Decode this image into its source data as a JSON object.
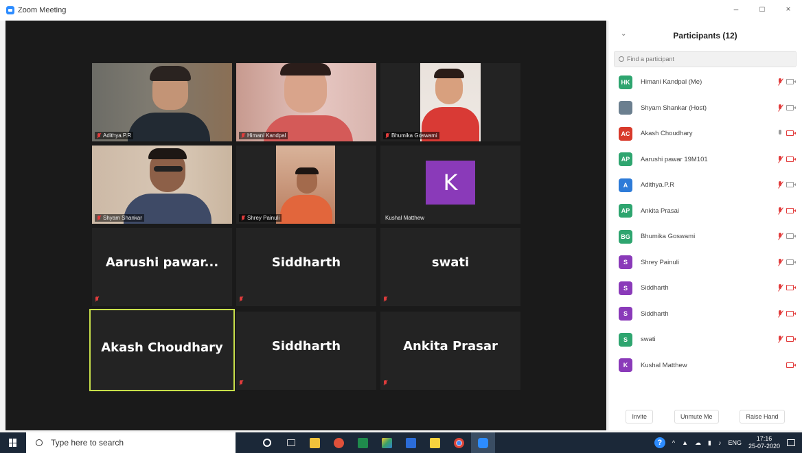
{
  "window": {
    "title": "Zoom Meeting",
    "min": "–",
    "max": "□",
    "close": "×"
  },
  "tiles": [
    {
      "name": "Adithya.P.R",
      "type": "video"
    },
    {
      "name": "Himani Kandpal",
      "type": "video"
    },
    {
      "name": "Bhumika Goswami",
      "type": "video"
    },
    {
      "name": "Shyam Shankar",
      "type": "video"
    },
    {
      "name": "Shrey Painuli",
      "type": "video"
    },
    {
      "name": "Kushal Matthew",
      "type": "avatar",
      "initial": "K"
    },
    {
      "name": "Aarushi  pawar...",
      "type": "name"
    },
    {
      "name": "Siddharth",
      "type": "name"
    },
    {
      "name": "swati",
      "type": "name"
    },
    {
      "name": "Akash Choudhary",
      "type": "name",
      "active": true
    },
    {
      "name": "Siddharth",
      "type": "name"
    },
    {
      "name": "Ankita Prasar",
      "type": "name"
    }
  ],
  "panel": {
    "title": "Participants (12)",
    "search_placeholder": "Find a participant",
    "participants": [
      {
        "initials": "HK",
        "name": "Himani Kandpal (Me)",
        "color": "#2ea56f",
        "mic": "muted",
        "cam": "on"
      },
      {
        "initials": "",
        "name": "Shyam Shankar (Host)",
        "color": "#6b7f8f",
        "mic": "muted",
        "cam": "on"
      },
      {
        "initials": "AC",
        "name": "Akash Choudhary",
        "color": "#d83a2b",
        "mic": "on",
        "cam": "off"
      },
      {
        "initials": "AP",
        "name": "Aarushi pawar 19M101",
        "color": "#2ea56f",
        "mic": "muted",
        "cam": "off"
      },
      {
        "initials": "A",
        "name": "Adithya.P.R",
        "color": "#2d7bd8",
        "mic": "muted",
        "cam": "on"
      },
      {
        "initials": "AP",
        "name": "Ankita Prasai",
        "color": "#2ea56f",
        "mic": "muted",
        "cam": "off"
      },
      {
        "initials": "BG",
        "name": "Bhumika Goswami",
        "color": "#2ea56f",
        "mic": "muted",
        "cam": "on"
      },
      {
        "initials": "S",
        "name": "Shrey Painuli",
        "color": "#8a3ab9",
        "mic": "muted",
        "cam": "on"
      },
      {
        "initials": "S",
        "name": "Siddharth",
        "color": "#8a3ab9",
        "mic": "muted",
        "cam": "off"
      },
      {
        "initials": "S",
        "name": "Siddharth",
        "color": "#8a3ab9",
        "mic": "muted",
        "cam": "off"
      },
      {
        "initials": "S",
        "name": "swati",
        "color": "#2ea56f",
        "mic": "muted",
        "cam": "off"
      },
      {
        "initials": "K",
        "name": "Kushal Matthew",
        "color": "#8a3ab9",
        "mic": "none",
        "cam": "off"
      }
    ],
    "buttons": {
      "invite": "Invite",
      "unmute": "Unmute Me",
      "raise": "Raise Hand"
    }
  },
  "taskbar": {
    "search_placeholder": "Type here to search",
    "tray": {
      "lang": "ENG",
      "time": "17:16",
      "date": "25-07-2020"
    }
  }
}
